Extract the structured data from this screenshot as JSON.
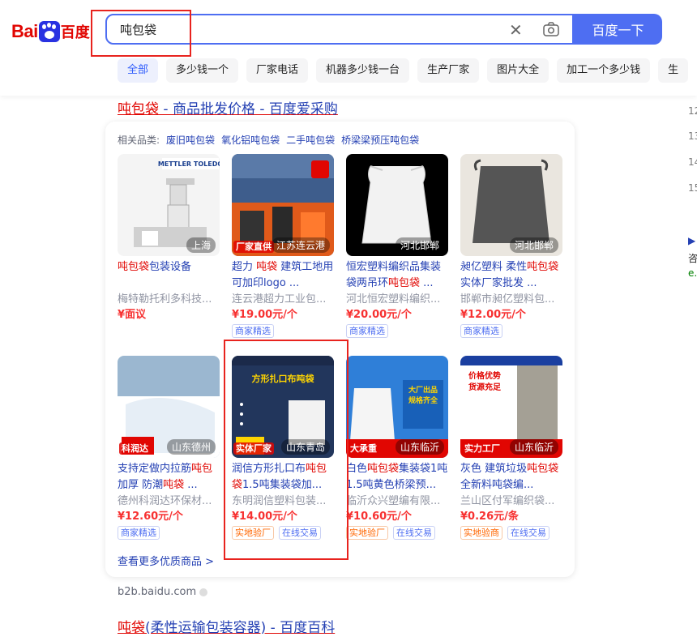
{
  "logo": {
    "text_left": "Bai",
    "text_right": "百度"
  },
  "search": {
    "value": "吨包袋",
    "button_label": "百度一下"
  },
  "tabs": [
    "全部",
    "多少钱一个",
    "厂家电话",
    "机器多少钱一台",
    "生产厂家",
    "图片大全",
    "加工一个多少钱",
    "生"
  ],
  "result1": {
    "title_hl": "吨包袋",
    "title_rest": " - 商品批发价格 - 百度爱采购"
  },
  "related": {
    "label": "相关品类:",
    "items": [
      "废旧吨包袋",
      "氧化铝吨包袋",
      "二手吨包袋",
      "桥梁梁预压吨包袋"
    ]
  },
  "products": [
    {
      "location": "上海",
      "name_parts": [
        [
          "吨包袋",
          1
        ],
        [
          "包装设备",
          0
        ]
      ],
      "seller": "梅特勒托利多科技...",
      "price": "¥面议",
      "tags": []
    },
    {
      "location": "江苏连云港",
      "badge": "厂家直供",
      "name_parts": [
        [
          "超力 ",
          0
        ],
        [
          "吨袋",
          1
        ],
        [
          " 建筑工地用可加印logo ...",
          0
        ]
      ],
      "seller": "连云港超力工业包...",
      "price": "¥19.00元/个",
      "tags": [
        [
          "商家精选",
          0
        ]
      ]
    },
    {
      "location": "河北邯郸",
      "name_parts": [
        [
          "恒宏塑料编织品集装袋两吊环",
          0
        ],
        [
          "吨包袋",
          1
        ],
        [
          " ...",
          0
        ]
      ],
      "seller": "河北恒宏塑料编织...",
      "price": "¥20.00元/个",
      "tags": [
        [
          "商家精选",
          0
        ]
      ]
    },
    {
      "location": "河北邯郸",
      "name_parts": [
        [
          "昶亿塑料 柔性",
          0
        ],
        [
          "吨包袋",
          1
        ],
        [
          " 实体厂家批发 ...",
          0
        ]
      ],
      "seller": "邯郸市昶亿塑料包...",
      "price": "¥12.00元/个",
      "tags": [
        [
          "商家精选",
          0
        ]
      ]
    },
    {
      "location": "山东德州",
      "badge": "科润达",
      "name_parts": [
        [
          "支持定做内拉筋",
          0
        ],
        [
          "吨包",
          1
        ],
        [
          " 加厚 防潮",
          0
        ],
        [
          "吨袋",
          1
        ],
        [
          " ...",
          0
        ]
      ],
      "seller": "德州科润达环保材...",
      "price": "¥12.60元/个",
      "tags": [
        [
          "商家精选",
          0
        ]
      ]
    },
    {
      "location": "山东青岛",
      "banner": "方形扎口布吨袋",
      "brand": "东明润信",
      "badge": "实体厂家",
      "name_parts": [
        [
          "润信方形扎口布",
          0
        ],
        [
          "吨包袋",
          1
        ],
        [
          "1.5吨集装袋加...",
          0
        ]
      ],
      "seller": "东明润信塑料包装...",
      "price": "¥14.00元/个",
      "tags": [
        [
          "实地验厂",
          1
        ],
        [
          "在线交易",
          0
        ]
      ]
    },
    {
      "location": "山东临沂",
      "badge": "大承重",
      "banner": "大厂出品 规格齐全",
      "name_parts": [
        [
          "白色",
          0
        ],
        [
          "吨包袋",
          1
        ],
        [
          "集装袋1吨1.5吨黄色桥梁预...",
          0
        ]
      ],
      "seller": "临沂众兴塑编有限...",
      "price": "¥10.60元/个",
      "tags": [
        [
          "实地验厂",
          1
        ],
        [
          "在线交易",
          0
        ]
      ]
    },
    {
      "location": "山东临沂",
      "badge": "实力工厂",
      "banner": "价格优势 货源充足",
      "name_parts": [
        [
          "灰色 建筑垃圾",
          0
        ],
        [
          "吨包袋",
          1
        ],
        [
          " 全新料吨袋编...",
          0
        ]
      ],
      "seller": "兰山区付军编织袋...",
      "price": "¥0.26元/条",
      "tags": [
        [
          "实地验商",
          1
        ],
        [
          "在线交易",
          0
        ]
      ]
    }
  ],
  "more_link": "查看更多优质商品 >",
  "site": "b2b.baidu.com",
  "result2": {
    "title_hl": "吨袋",
    "title_rest": "(柔性运输包装容器) - 百度百科"
  },
  "side_numbers": [
    "12",
    "13",
    "14",
    "15"
  ],
  "side_extra": [
    "▶",
    "咨",
    "e."
  ]
}
